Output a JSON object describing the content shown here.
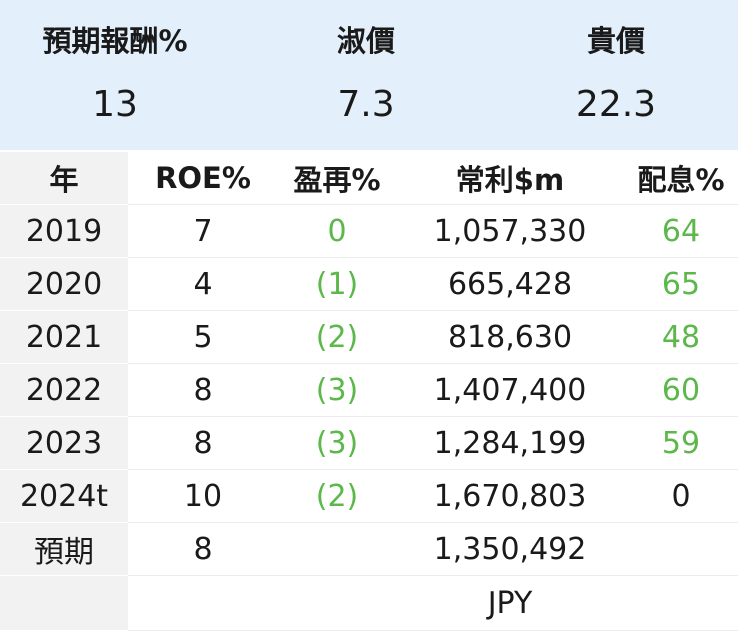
{
  "summary": [
    {
      "label": "預期報酬%",
      "value": "13"
    },
    {
      "label": "淑價",
      "value": "7.3"
    },
    {
      "label": "貴價",
      "value": "22.3"
    }
  ],
  "table": {
    "headers": [
      "年",
      "ROE%",
      "盈再%",
      "常利$m",
      "配息%"
    ],
    "rows": [
      {
        "year": "2019",
        "roe": "7",
        "reinvest": "0",
        "profit": "1,057,330",
        "payout": "64"
      },
      {
        "year": "2020",
        "roe": "4",
        "reinvest": "(1)",
        "profit": "665,428",
        "payout": "65"
      },
      {
        "year": "2021",
        "roe": "5",
        "reinvest": "(2)",
        "profit": "818,630",
        "payout": "48"
      },
      {
        "year": "2022",
        "roe": "8",
        "reinvest": "(3)",
        "profit": "1,407,400",
        "payout": "60"
      },
      {
        "year": "2023",
        "roe": "8",
        "reinvest": "(3)",
        "profit": "1,284,199",
        "payout": "59"
      },
      {
        "year": "2024t",
        "roe": "10",
        "reinvest": "(2)",
        "profit": "1,670,803",
        "payout": "0"
      },
      {
        "year": "預期",
        "roe": "8",
        "reinvest": "",
        "profit": "1,350,492",
        "payout": ""
      }
    ],
    "currency": "JPY"
  },
  "colors": {
    "highlight_green": "#5cb84a",
    "summary_bg": "#e3f0fb",
    "year_col_bg": "#f2f2f2"
  }
}
